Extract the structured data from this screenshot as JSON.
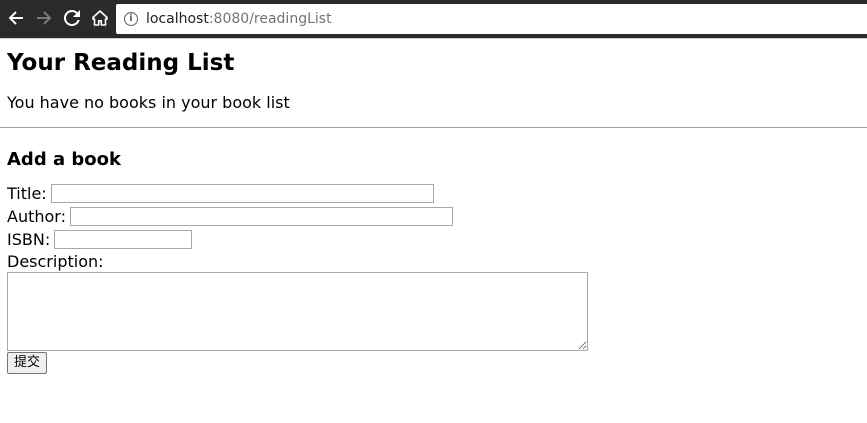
{
  "browser": {
    "url_host": "localhost",
    "url_rest": ":8080/readingList",
    "icons": {
      "back": "back-arrow-icon",
      "forward": "forward-arrow-icon",
      "reload": "reload-icon",
      "home": "home-icon",
      "info": "info-icon"
    },
    "info_glyph": "i"
  },
  "page": {
    "title": "Your Reading List",
    "empty_message": "You have no books in your book list",
    "form_title": "Add a book",
    "form": {
      "title_label": "Title:",
      "title_value": "",
      "author_label": "Author:",
      "author_value": "",
      "isbn_label": "ISBN:",
      "isbn_value": "",
      "description_label": "Description:",
      "description_value": "",
      "submit_label": "提交"
    }
  }
}
